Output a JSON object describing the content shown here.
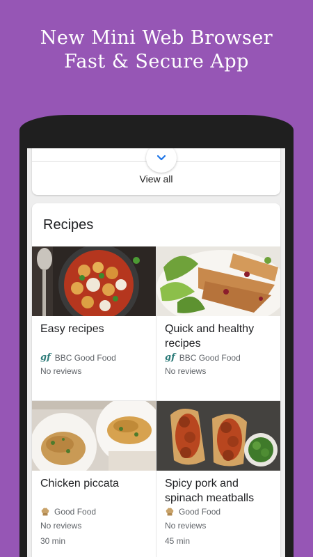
{
  "promo": {
    "line1": "New Mini Web Browser",
    "line2": "Fast & Secure App"
  },
  "top_card": {
    "view_all_label": "View all",
    "expand_icon": "chevron-down-icon"
  },
  "recipes": {
    "title": "Recipes",
    "items": [
      {
        "name": "Easy recipes",
        "source": "BBC Good Food",
        "source_icon": "gf",
        "reviews": "No reviews",
        "time": ""
      },
      {
        "name": "Quick and healthy recipes",
        "source": "BBC Good Food",
        "source_icon": "gf",
        "reviews": "No reviews",
        "time": ""
      },
      {
        "name": "Chicken piccata",
        "source": "Good Food",
        "source_icon": "chef-hat",
        "reviews": "No reviews",
        "time": "30 min"
      },
      {
        "name": "Spicy pork and spinach meatballs",
        "source": "Good Food",
        "source_icon": "chef-hat",
        "reviews": "No reviews",
        "time": "45 min"
      }
    ]
  },
  "colors": {
    "background": "#9656b5",
    "phone_frame": "#1f1f1f",
    "accent_blue": "#1a73e8"
  }
}
